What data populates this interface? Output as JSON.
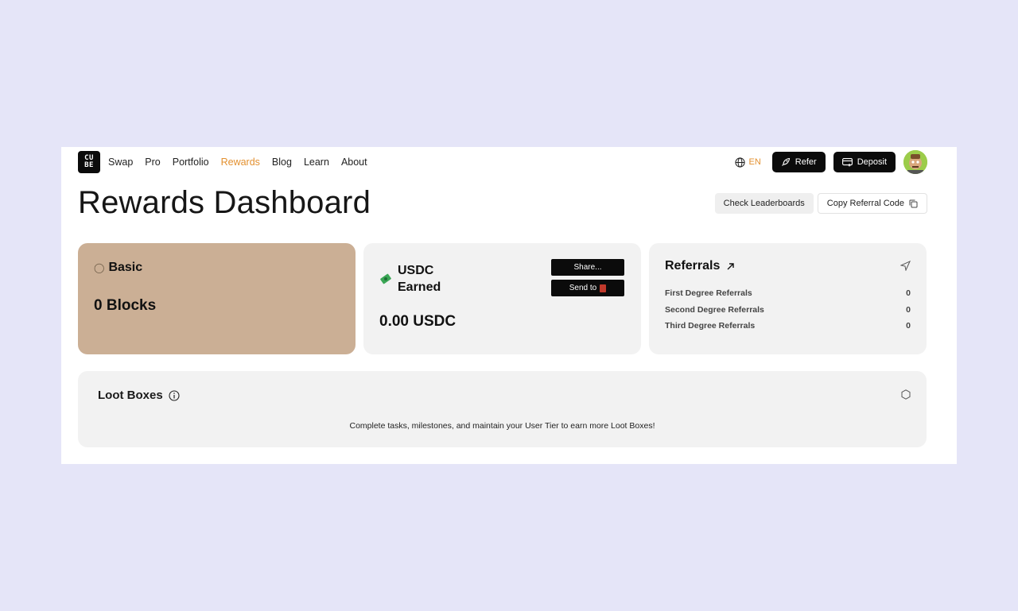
{
  "nav": {
    "logo_top": "CU",
    "logo_bottom": "BE",
    "links": [
      "Swap",
      "Pro",
      "Portfolio",
      "Rewards",
      "Blog",
      "Learn",
      "About"
    ],
    "active": "Rewards",
    "language": "EN",
    "refer_label": "Refer",
    "deposit_label": "Deposit"
  },
  "page": {
    "title": "Rewards Dashboard",
    "check_leaderboards": "Check Leaderboards",
    "copy_referral": "Copy Referral Code"
  },
  "tier_card": {
    "tier": "Basic",
    "blocks": "0 Blocks"
  },
  "usdc_card": {
    "label": "USDC Earned",
    "amount": "0.00 USDC",
    "share_label": "Share...",
    "send_label": "Send to"
  },
  "referrals_card": {
    "title": "Referrals",
    "rows": [
      {
        "label": "First Degree Referrals",
        "value": "0"
      },
      {
        "label": "Second Degree Referrals",
        "value": "0"
      },
      {
        "label": "Third Degree Referrals",
        "value": "0"
      }
    ]
  },
  "loot_boxes": {
    "title": "Loot Boxes",
    "message": "Complete tasks, milestones, and maintain your User Tier to earn more Loot Boxes!"
  },
  "colors": {
    "accent": "#e3902f",
    "tier_card": "#cbaf95",
    "card_bg": "#f2f2f2",
    "page_bg": "#e5e5f8",
    "button_dark": "#0b0b0b"
  }
}
